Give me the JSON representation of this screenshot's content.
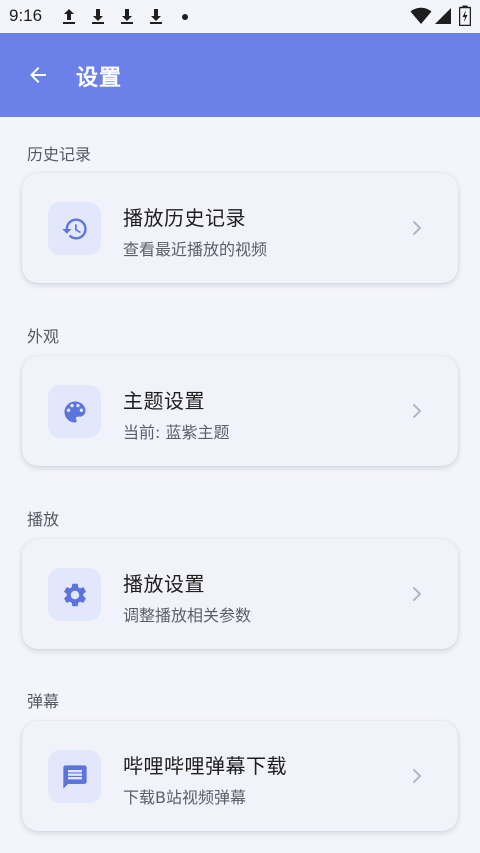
{
  "status_bar": {
    "time": "9:16",
    "icons": [
      "upload-icon",
      "download-icon",
      "download-icon",
      "download-icon",
      "dot-icon",
      "wifi-icon",
      "signal-icon",
      "battery-charging-icon"
    ]
  },
  "app_bar": {
    "title": "设置",
    "back_icon": "arrow-back-icon",
    "color": "#6b80e8"
  },
  "sections": [
    {
      "header": "历史记录",
      "item": {
        "icon": "history-icon",
        "title": "播放历史记录",
        "subtitle": "查看最近播放的视频"
      }
    },
    {
      "header": "外观",
      "item": {
        "icon": "palette-icon",
        "title": "主题设置",
        "subtitle": "当前: 蓝紫主题"
      }
    },
    {
      "header": "播放",
      "item": {
        "icon": "gear-icon",
        "title": "播放设置",
        "subtitle": "调整播放相关参数"
      }
    },
    {
      "header": "弹幕",
      "item": {
        "icon": "message-icon",
        "title": "哔哩哔哩弹幕下载",
        "subtitle": "下载B站视频弹幕"
      }
    }
  ],
  "colors": {
    "accent": "#6b80e8",
    "icon_fg": "#5d74dd",
    "icon_bg": "#e3e7fb",
    "background": "#f4f5fa"
  }
}
